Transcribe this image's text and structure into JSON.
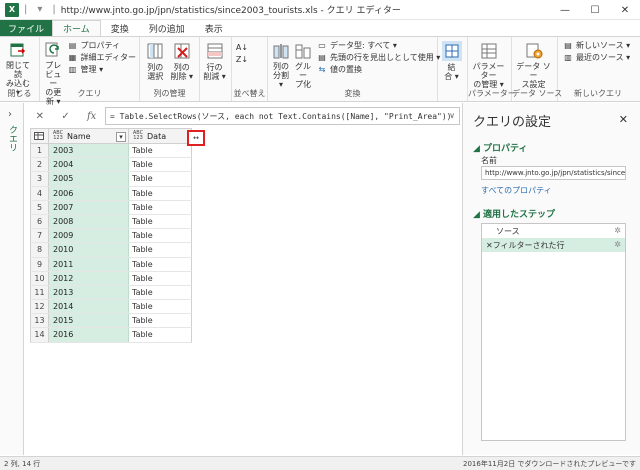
{
  "window": {
    "app_icon": "excel-icon",
    "title": "http://www.jnto.go.jp/jpn/statistics/since2003_tourists.xls - クエリ エディター",
    "controls": [
      "minimize-icon",
      "maximize-icon",
      "close-icon"
    ]
  },
  "tabs": [
    {
      "label": "ファイル"
    },
    {
      "label": "ホーム"
    },
    {
      "label": "変換"
    },
    {
      "label": "列の追加"
    },
    {
      "label": "表示"
    }
  ],
  "ribbon": {
    "close": {
      "label": "閉じる",
      "close_load": "閉じて読\nみ込む ▾"
    },
    "query": {
      "label": "クエリ",
      "preview": "プレビュー\nの更新 ▾",
      "properties": "プロパティ",
      "advanced_editor": "詳細エディター",
      "manage": "管理 ▾"
    },
    "manage_columns": {
      "label": "列の管理",
      "choose": "列の\n選択",
      "remove": "列の\n削除 ▾"
    },
    "reduce_rows": {
      "label": "",
      "remove_rows": "行の\n削減 ▾"
    },
    "sort": {
      "label": "並べ替え"
    },
    "transform": {
      "label": "変換",
      "split": "列の\n分割 ▾",
      "group": "グルー\nプ化",
      "data_type": "データ型: すべて ▾",
      "first_row_header": "先頭の行を見出しとして使用 ▾",
      "replace_values": "値の置換"
    },
    "combine": {
      "label": "",
      "combine": "結\n合 ▾"
    },
    "parameters": {
      "label": "パラメーター",
      "manage_params": "パラメーター\nの管理 ▾"
    },
    "data_source": {
      "label": "データ ソース",
      "settings": "データ ソー\nス設定"
    },
    "new_query": {
      "label": "新しいクエリ",
      "new_source": "新しいソース ▾",
      "recent_source": "最近のソース ▾"
    }
  },
  "left_pane": {
    "label": "クエリ",
    "toggle": "›"
  },
  "formula_bar": {
    "cancel": "✕",
    "accept": "✓",
    "fx": "fx",
    "formula": "= Table.SelectRows(ソース, each not Text.Contains([Name], \"Print_Area\"))",
    "expand": "∨"
  },
  "grid": {
    "columns": [
      {
        "name": "Name",
        "type": "ABC\n123"
      },
      {
        "name": "Data",
        "type": "ABC\n123"
      }
    ],
    "rows": [
      {
        "num": "1",
        "name": "2003",
        "data": "Table"
      },
      {
        "num": "2",
        "name": "2004",
        "data": "Table"
      },
      {
        "num": "3",
        "name": "2005",
        "data": "Table"
      },
      {
        "num": "4",
        "name": "2006",
        "data": "Table"
      },
      {
        "num": "5",
        "name": "2007",
        "data": "Table"
      },
      {
        "num": "6",
        "name": "2008",
        "data": "Table"
      },
      {
        "num": "7",
        "name": "2009",
        "data": "Table"
      },
      {
        "num": "8",
        "name": "2010",
        "data": "Table"
      },
      {
        "num": "9",
        "name": "2011",
        "data": "Table"
      },
      {
        "num": "10",
        "name": "2012",
        "data": "Table"
      },
      {
        "num": "11",
        "name": "2013",
        "data": "Table"
      },
      {
        "num": "12",
        "name": "2014",
        "data": "Table"
      },
      {
        "num": "13",
        "name": "2015",
        "data": "Table"
      },
      {
        "num": "14",
        "name": "2016",
        "data": "Table"
      }
    ],
    "expand_button": "↔",
    "filter_button": "▾"
  },
  "query_settings": {
    "title": "クエリの設定",
    "close": "✕",
    "properties_header": "◢ プロパティ",
    "name_label": "名前",
    "name_value": "http://www.jnto.go.jp/jpn/statistics/since2",
    "all_properties": "すべてのプロパティ",
    "steps_header": "◢ 適用したステップ",
    "steps": [
      {
        "label": "ソース",
        "prefix": ""
      },
      {
        "label": "フィルターされた行",
        "prefix": "✕ "
      }
    ]
  },
  "status": {
    "left": "2 列, 14 行",
    "right": "2016年11月2日 でダウンロードされたプレビューです"
  },
  "colors": {
    "accent": "#217346",
    "highlight": "#d6eee2",
    "red_box": "#e02020"
  }
}
